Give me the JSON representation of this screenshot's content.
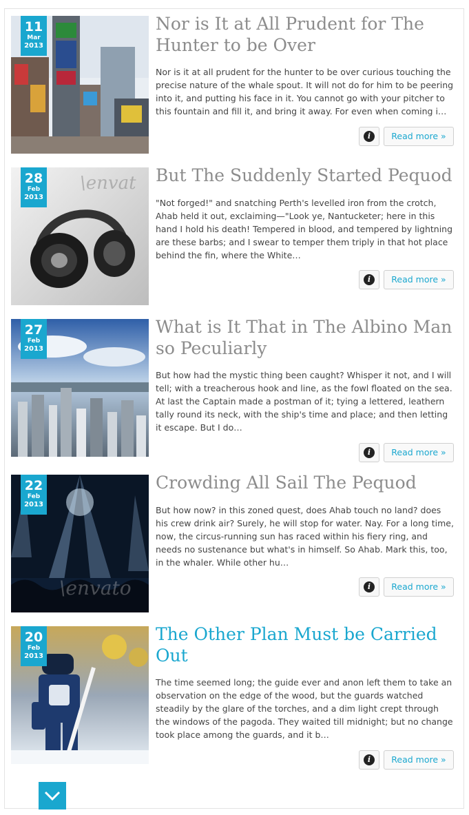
{
  "posts": [
    {
      "day": "11",
      "month": "Mar",
      "year": "2013",
      "title": "Nor is It at All Prudent for The Hunter to be Over",
      "excerpt": "Nor is it at all prudent for the hunter to be over curious touching the precise nature of the whale spout. It will not do for him to be peering into it, and putting his face in it. You cannot go with your pitcher to this fountain and fill it, and bring it away. For even when coming i…",
      "info_icon": "info-icon",
      "read_more": "Read more »"
    },
    {
      "day": "28",
      "month": "Feb",
      "year": "2013",
      "title": "But The Suddenly Started Pequod",
      "excerpt": "\"Not forged!\" and snatching Perth's levelled iron from the crotch, Ahab held it out, exclaiming—\"Look ye, Nantucketer; here in this hand I hold his death! Tempered in blood, and tempered by lightning are these barbs; and I swear to temper them triply in that hot place behind the fin, where the White…",
      "watermark": "\\envat",
      "info_icon": "info-icon",
      "read_more": "Read more »"
    },
    {
      "day": "27",
      "month": "Feb",
      "year": "2013",
      "title": "What is It That in The Albino Man so Peculiarly",
      "excerpt": "But how had the mystic thing been caught? Whisper it not, and I will tell; with a treacherous hook and line, as the fowl floated on the sea. At last the Captain made a postman of it; tying a lettered, leathern tally round its neck, with the ship's time and place; and then letting it escape. But I do…",
      "info_icon": "info-icon",
      "read_more": "Read more »"
    },
    {
      "day": "22",
      "month": "Feb",
      "year": "2013",
      "title": "Crowding All Sail The Pequod",
      "excerpt": "But how now? in this zoned quest, does Ahab touch no land? does his crew drink air? Surely, he will stop for water. Nay. For a long time, now, the circus-running sun has raced within his fiery ring, and needs no sustenance but what's in himself. So Ahab. Mark this, too, in the whaler. While other hu…",
      "watermark": "\\envato",
      "info_icon": "info-icon",
      "read_more": "Read more »"
    },
    {
      "day": "20",
      "month": "Feb",
      "year": "2013",
      "title": "The Other Plan Must be Carried Out",
      "excerpt": "The time seemed long; the guide ever and anon left them to take an observation on the edge of the wood, but the guards watched steadily by the glare of the torches, and a dim light crept through the windows of the pagoda. They waited till midnight; but no change took place among the guards, and it b…",
      "info_icon": "info-icon",
      "read_more": "Read more »"
    }
  ],
  "scroll_icon": "chevron-down-icon",
  "colors": {
    "accent": "#1aa7cf",
    "title_gray": "#8c8c8c",
    "text": "#444444"
  }
}
